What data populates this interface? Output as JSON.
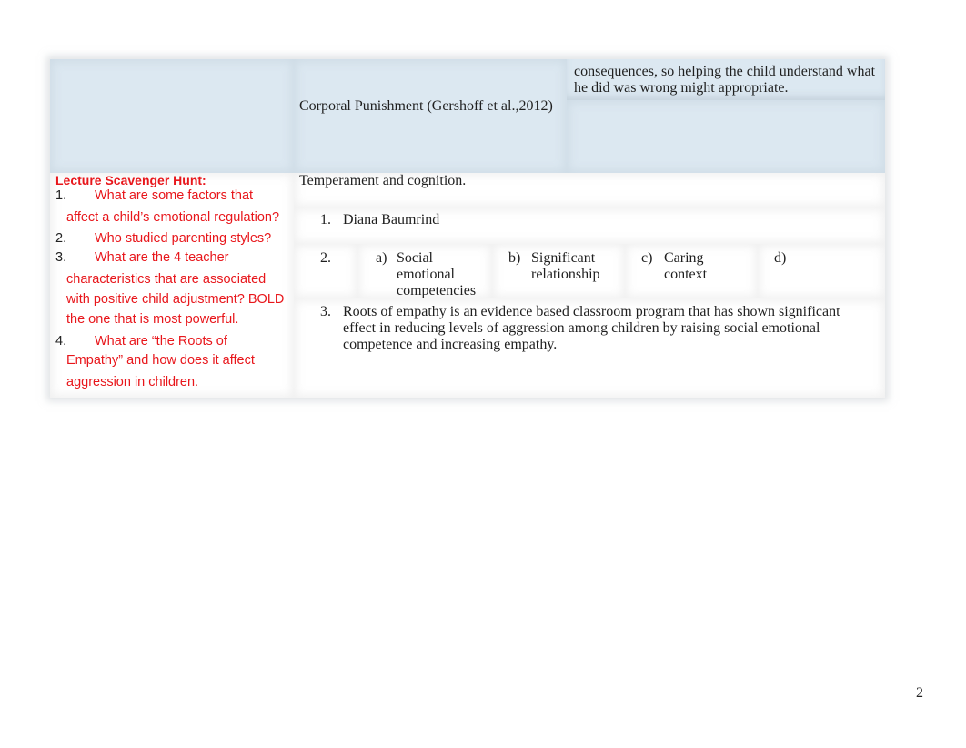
{
  "document": {
    "page_number": "2",
    "colors": {
      "header_fill": "#dce8f1",
      "question_text": "#e8161b",
      "body_text": "#1f1f1f"
    },
    "header_row": {
      "col1_text": "",
      "col2_text": "Corporal Punishment (Gershoff et al.,2012)",
      "col3_line1": "consequences, so helping the child understand what",
      "col3_line2": "he did was wrong might appropriate."
    },
    "scavenger_hunt": {
      "title": "Lecture Scavenger Hunt:",
      "questions": [
        {
          "number": "1.",
          "lines": [
            "What are some factors that",
            "affect a child’s emotional regulation?"
          ]
        },
        {
          "number": "2.",
          "lines": [
            "Who studied parenting styles?"
          ]
        },
        {
          "number": "3.",
          "lines": [
            "What are the 4 teacher",
            "characteristics that are associated",
            "with positive child adjustment? BOLD",
            "the one that is most powerful."
          ]
        },
        {
          "number": "4.",
          "lines": [
            "What are “the Roots of",
            "Empathy” and how does it affect",
            "aggression in children."
          ]
        }
      ]
    },
    "answers": {
      "intro": "Temperament and cognition.",
      "items": [
        {
          "number": "1.",
          "text": "Diana Baumrind"
        },
        {
          "number": "2.",
          "options": [
            {
              "letter": "a)",
              "lines": [
                "Social",
                "emotional",
                "competencies"
              ]
            },
            {
              "letter": "b)",
              "lines": [
                "Significant",
                "relationship"
              ]
            },
            {
              "letter": "c)",
              "lines": [
                "Caring",
                "context"
              ]
            },
            {
              "letter": "d)",
              "lines": []
            }
          ]
        },
        {
          "number": "3.",
          "lines": [
            "Roots of empathy is an evidence based classroom program that has shown significant",
            "effect in reducing levels of aggression among children by raising social emotional",
            "competence and increasing empathy."
          ]
        }
      ]
    }
  }
}
